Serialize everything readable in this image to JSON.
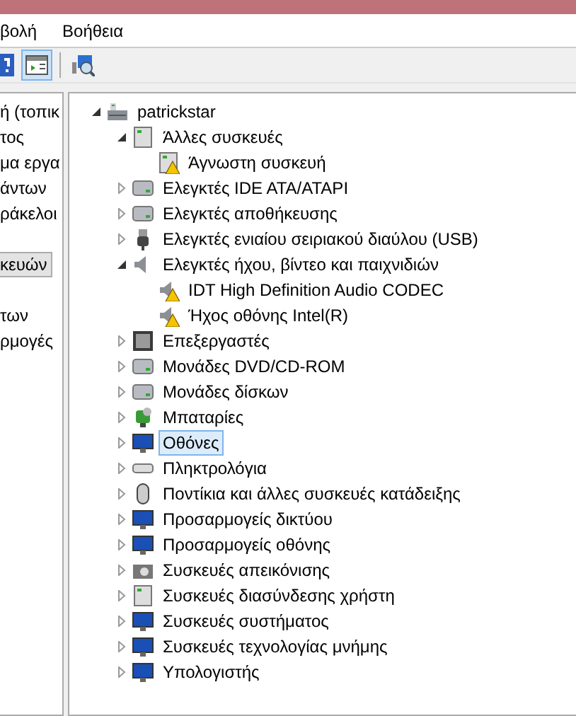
{
  "menu": [
    "βολή",
    "Βοήθεια"
  ],
  "toolbar": [
    {
      "selected": false
    },
    {
      "selected": true
    },
    {
      "selected": false
    }
  ],
  "left_pane": {
    "groups": [
      {
        "items": [
          {
            "label": "ή (τοπικ",
            "selected": false
          },
          {
            "label": "τος",
            "selected": false
          },
          {
            "label": "μα εργα",
            "selected": false
          },
          {
            "label": "άντων",
            "selected": false
          },
          {
            "label": "ράκελοι",
            "selected": false
          }
        ]
      },
      {
        "items": [
          {
            "label": "κευών",
            "selected": true
          }
        ]
      },
      {
        "items": [
          {
            "label": "των",
            "selected": false
          },
          {
            "label": "ρμογές",
            "selected": false
          }
        ]
      }
    ]
  },
  "tree": {
    "label": "patrickstar",
    "expanded": true,
    "selected": false,
    "children": [
      {
        "label": "Άλλες συσκευές",
        "expanded": true,
        "selected": false,
        "warning": false,
        "children": [
          {
            "label": "Άγνωστη συσκευή",
            "selected": false,
            "warning": true
          }
        ]
      },
      {
        "label": "Ελεγκτές IDE ATA/ATAPI",
        "expanded": false,
        "selected": false,
        "warning": false
      },
      {
        "label": "Ελεγκτές αποθήκευσης",
        "expanded": false,
        "selected": false,
        "warning": false
      },
      {
        "label": "Ελεγκτές ενιαίου σειριακού διαύλου (USB)",
        "expanded": false,
        "selected": false,
        "warning": false
      },
      {
        "label": "Ελεγκτές ήχου, βίντεο και παιχνιδιών",
        "expanded": true,
        "selected": false,
        "warning": false,
        "children": [
          {
            "label": "IDT High Definition Audio CODEC",
            "selected": false,
            "warning": true
          },
          {
            "label": "Ήχος οθόνης Intel(R)",
            "selected": false,
            "warning": true
          }
        ]
      },
      {
        "label": "Επεξεργαστές",
        "expanded": false,
        "selected": false,
        "warning": false
      },
      {
        "label": "Μονάδες DVD/CD-ROM",
        "expanded": false,
        "selected": false,
        "warning": false
      },
      {
        "label": "Μονάδες δίσκων",
        "expanded": false,
        "selected": false,
        "warning": false
      },
      {
        "label": "Μπαταρίες",
        "expanded": false,
        "selected": false,
        "warning": false
      },
      {
        "label": "Οθόνες",
        "expanded": false,
        "selected": true,
        "warning": false
      },
      {
        "label": "Πληκτρολόγια",
        "expanded": false,
        "selected": false,
        "warning": false
      },
      {
        "label": "Ποντίκια και άλλες συσκευές κατάδειξης",
        "expanded": false,
        "selected": false,
        "warning": false
      },
      {
        "label": "Προσαρμογείς δικτύου",
        "expanded": false,
        "selected": false,
        "warning": false
      },
      {
        "label": "Προσαρμογείς οθόνης",
        "expanded": false,
        "selected": false,
        "warning": false
      },
      {
        "label": "Συσκευές απεικόνισης",
        "expanded": false,
        "selected": false,
        "warning": false
      },
      {
        "label": "Συσκευές διασύνδεσης χρήστη",
        "expanded": false,
        "selected": false,
        "warning": false
      },
      {
        "label": "Συσκευές συστήματος",
        "expanded": false,
        "selected": false,
        "warning": false
      },
      {
        "label": "Συσκευές τεχνολογίας μνήμης",
        "expanded": false,
        "selected": false,
        "warning": false
      },
      {
        "label": "Υπολογιστής",
        "expanded": false,
        "selected": false,
        "warning": false
      }
    ]
  }
}
